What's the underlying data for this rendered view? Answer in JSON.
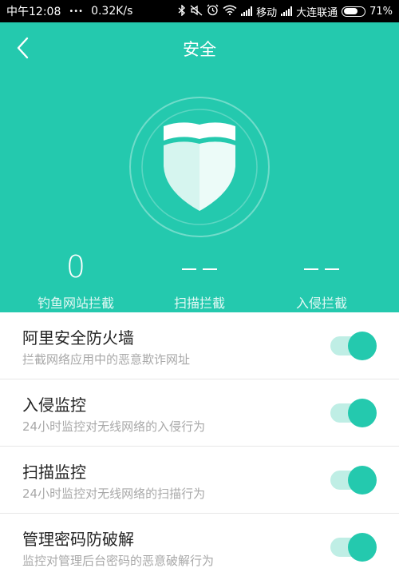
{
  "status_bar": {
    "time": "中午12:08",
    "dots": "•••",
    "speed": "0.32K/s",
    "icons": [
      "bluetooth-icon",
      "mute-icon",
      "alarm-icon",
      "wifi-icon",
      "signal-icon"
    ],
    "carrier1": "移动",
    "carrier2": "大连联通",
    "battery": "71%",
    "battery_level": 0.71
  },
  "header": {
    "title": "安全",
    "back_icon": "chevron-left-icon",
    "shield_icon": "shield-icon",
    "bg_color": "#24c9ae"
  },
  "stats": [
    {
      "value": "0",
      "label": "钓鱼网站拦截"
    },
    {
      "value": "",
      "label": "扫描拦截"
    },
    {
      "value": "",
      "label": "入侵拦截"
    }
  ],
  "settings": [
    {
      "title": "阿里安全防火墙",
      "desc": "拦截网络应用中的恶意欺诈网址",
      "enabled": true
    },
    {
      "title": "入侵监控",
      "desc": "24小时监控对无线网络的入侵行为",
      "enabled": true
    },
    {
      "title": "扫描监控",
      "desc": "24小时监控对无线网络的扫描行为",
      "enabled": true
    },
    {
      "title": "管理密码防破解",
      "desc": "监控对管理后台密码的恶意破解行为",
      "enabled": true
    }
  ],
  "colors": {
    "accent": "#24c9ae",
    "toggle_track": "#bfeee5"
  }
}
